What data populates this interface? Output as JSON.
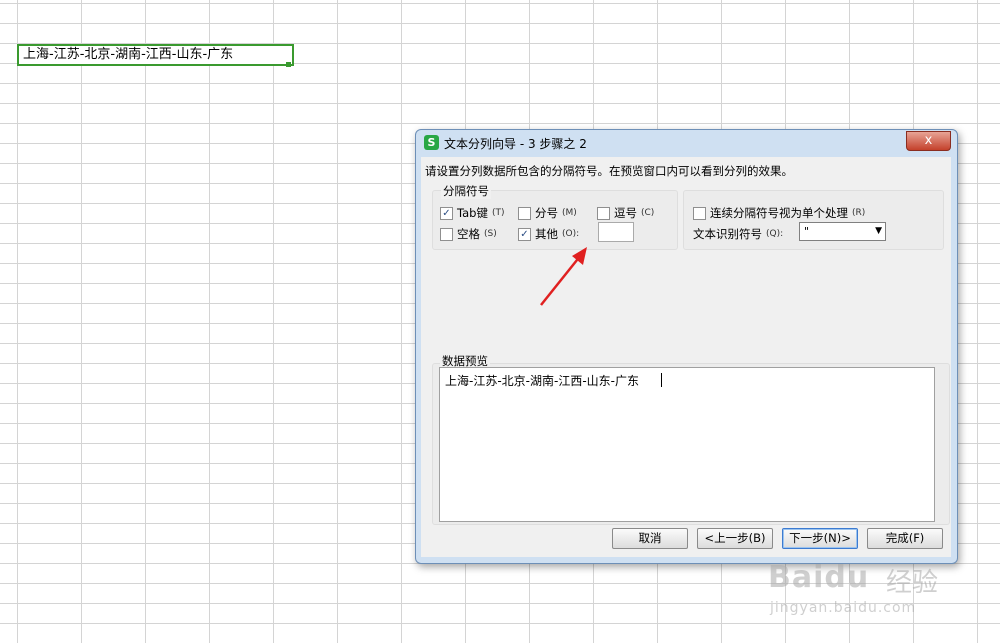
{
  "spreadsheet": {
    "active_cell_value": "上海-江苏-北京-湖南-江西-山东-广东"
  },
  "dialog": {
    "title": "文本分列向导 - 3 步骤之 2",
    "close_glyph": "x",
    "app_icon_glyph": "S",
    "instruction": "请设置分列数据所包含的分隔符号。在预览窗口内可以看到分列的效果。",
    "delimiters": {
      "legend": "分隔符号",
      "tab": {
        "label": "Tab键",
        "hotkey": "(T)",
        "checked": true
      },
      "semicolon": {
        "label": "分号",
        "hotkey": "(M)",
        "checked": false
      },
      "comma": {
        "label": "逗号",
        "hotkey": "(C)",
        "checked": false
      },
      "space": {
        "label": "空格",
        "hotkey": "(S)",
        "checked": false
      },
      "other": {
        "label": "其他",
        "hotkey": "(O):",
        "checked": true,
        "value": ""
      }
    },
    "consecutive": {
      "label": "连续分隔符号视为单个处理",
      "hotkey": "(R)",
      "checked": false
    },
    "qualifier": {
      "label": "文本识别符号",
      "hotkey": "(Q):",
      "value": "\""
    },
    "preview": {
      "legend": "数据预览",
      "line": "上海-江苏-北京-湖南-江西-山东-广东"
    },
    "buttons": {
      "cancel": "取消",
      "back": "<上一步(B)",
      "next": "下一步(N)>",
      "finish": "完成(F)"
    }
  },
  "watermark": {
    "logo": "Baidu",
    "cn": "经验",
    "url": "jingyan.baidu.com"
  },
  "colors": {
    "cell_border": "#3a9a2f",
    "arrow": "#e02020"
  }
}
